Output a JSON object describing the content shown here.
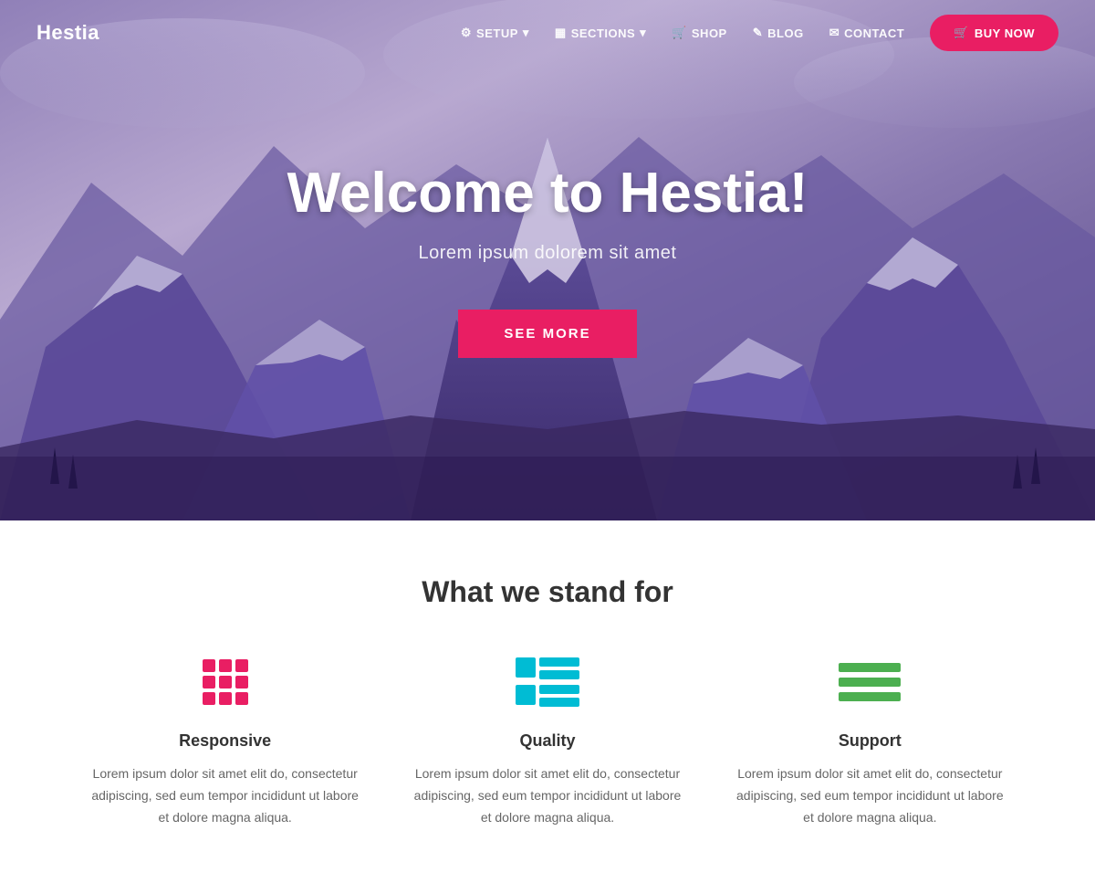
{
  "brand": "Hestia",
  "nav": {
    "items": [
      {
        "id": "setup",
        "label": "SETUP",
        "icon": "⚙",
        "hasDropdown": true
      },
      {
        "id": "sections",
        "label": "SECTIONS",
        "icon": "▦",
        "hasDropdown": true
      },
      {
        "id": "shop",
        "label": "SHOP",
        "icon": "🛒"
      },
      {
        "id": "blog",
        "label": "BLOG",
        "icon": "✎"
      },
      {
        "id": "contact",
        "label": "CONTACT",
        "icon": "✉"
      }
    ],
    "cta": {
      "label": "BUY NOW",
      "icon": "🛒"
    }
  },
  "hero": {
    "title": "Welcome to Hestia!",
    "subtitle": "Lorem ipsum dolorem sit amet",
    "cta_label": "SEE MORE"
  },
  "features": {
    "section_title": "What we stand for",
    "items": [
      {
        "id": "responsive",
        "name": "Responsive",
        "description": "Lorem ipsum dolor sit amet elit do, consectetur adipiscing, sed eum tempor incididunt ut labore et dolore magna aliqua.",
        "icon_type": "grid",
        "color": "#e91e63"
      },
      {
        "id": "quality",
        "name": "Quality",
        "description": "Lorem ipsum dolor sit amet elit do, consectetur adipiscing, sed eum tempor incididunt ut labore et dolore magna aliqua.",
        "icon_type": "table",
        "color": "#00bcd4"
      },
      {
        "id": "support",
        "name": "Support",
        "description": "Lorem ipsum dolor sit amet elit do, consectetur adipiscing, sed eum tempor incididunt ut labore et dolore magna aliqua.",
        "icon_type": "lines",
        "color": "#4caf50"
      }
    ]
  },
  "colors": {
    "accent": "#e91e63",
    "cyan": "#00bcd4",
    "green": "#4caf50",
    "hero_overlay": "rgba(60,40,100,0.45)"
  }
}
